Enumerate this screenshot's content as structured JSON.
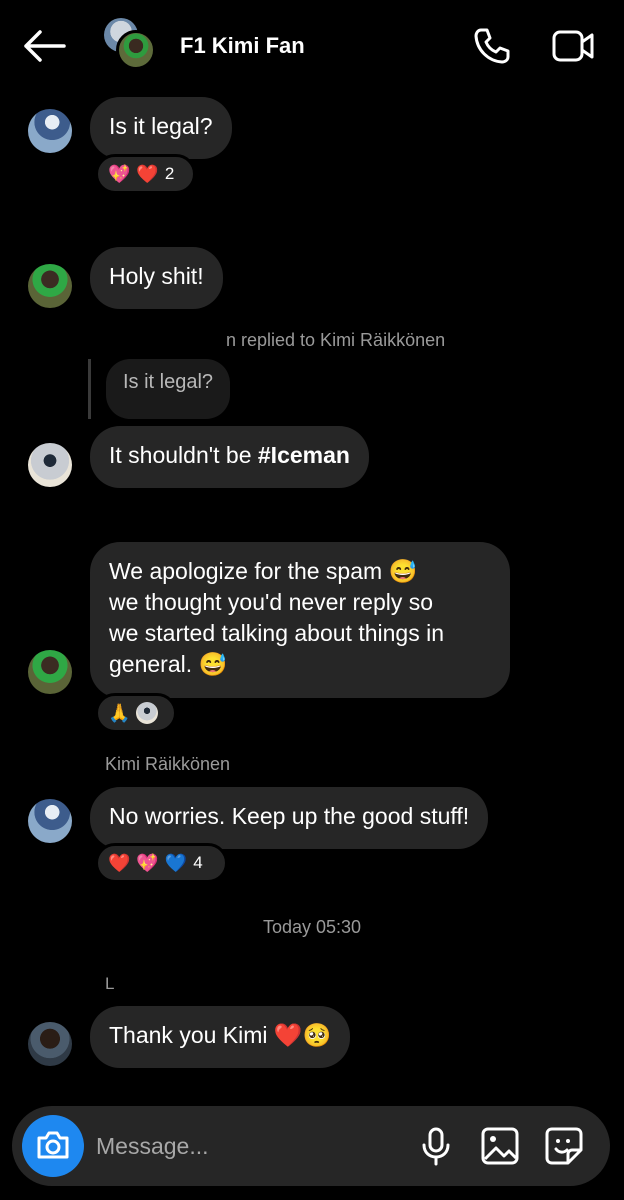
{
  "header": {
    "title": "F1 Kimi Fan"
  },
  "messages": [
    {
      "text": "Is it legal?",
      "reactions": {
        "emojis": [
          "💖",
          "❤️"
        ],
        "count": "2"
      }
    },
    {
      "text": "Holy shit!"
    },
    {
      "reply_meta": "n replied to Kimi Räikkönen",
      "quoted": "Is it legal?",
      "text_prefix": "It shouldn't be ",
      "hashtag": "#Iceman"
    },
    {
      "lines": [
        "We apologize for the spam 😅",
        "we thought you'd never reply so",
        "we started talking about things in",
        "general. 😅"
      ],
      "reactions": {
        "emojis": [
          "🙏"
        ]
      }
    },
    {
      "sender": "Kimi Räikkönen",
      "text": "No worries. Keep up the good stuff!",
      "reactions": {
        "emojis": [
          "❤️",
          "💖",
          "💙"
        ],
        "count": "4"
      }
    },
    {
      "timestamp": "Today 05:30",
      "sender_partial": "L",
      "text": "Thank you Kimi ❤️🥺"
    }
  ],
  "composer": {
    "placeholder": "Message..."
  },
  "icons": [
    "back-arrow-icon",
    "phone-icon",
    "video-camera-icon",
    "camera-icon",
    "microphone-icon",
    "gallery-icon",
    "sticker-icon"
  ],
  "colors": {
    "background": "#000000",
    "bubble": "#262626",
    "accent": "#1e88f0",
    "meta": "#9a9a9a"
  }
}
